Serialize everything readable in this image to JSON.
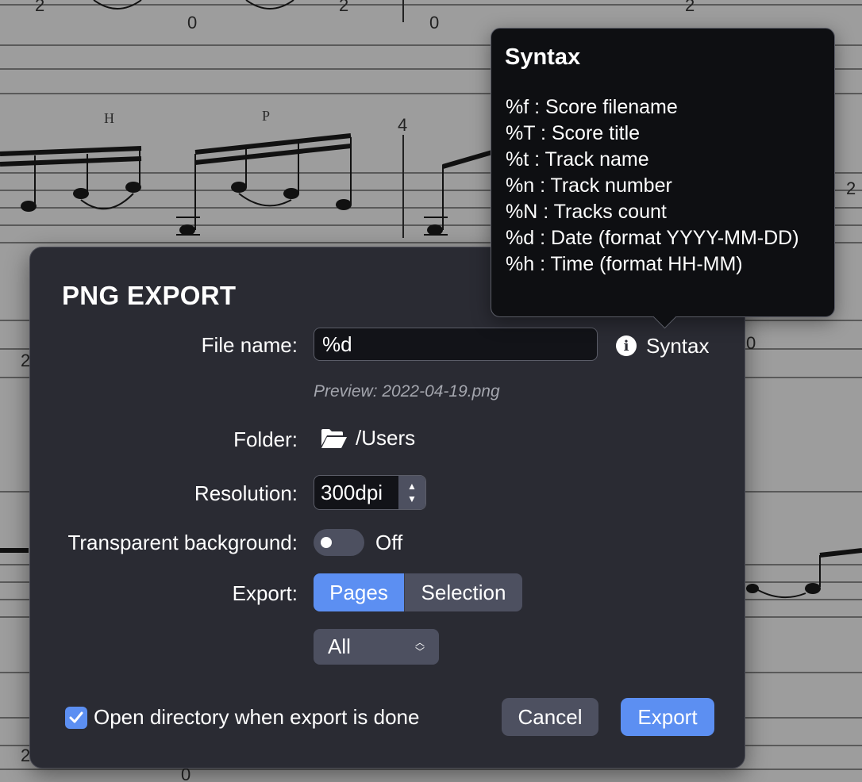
{
  "background_score": {
    "technique_marks": [
      "H",
      "P"
    ],
    "measure_number": "4",
    "tab_numbers": [
      "2",
      "0",
      "2",
      "0",
      "2",
      "2",
      "0",
      "2",
      "2",
      "0"
    ]
  },
  "dialog": {
    "title": "PNG EXPORT",
    "file_name": {
      "label": "File name:",
      "value": "%d",
      "syntax_label": "Syntax",
      "preview": "Preview: 2022-04-19.png"
    },
    "folder": {
      "label": "Folder:",
      "path": "/Users",
      "icon": "folder-open-icon"
    },
    "resolution": {
      "label": "Resolution:",
      "value": "300dpi"
    },
    "transparent_background": {
      "label": "Transparent background:",
      "state": "Off",
      "enabled": false
    },
    "export": {
      "label": "Export:",
      "options": [
        "Pages",
        "Selection"
      ],
      "selected": "Pages",
      "range_value": "All"
    },
    "open_directory": {
      "label": "Open directory when export is done",
      "checked": true
    },
    "buttons": {
      "cancel": "Cancel",
      "export": "Export"
    }
  },
  "tooltip": {
    "title": "Syntax",
    "lines": [
      "%f : Score filename",
      "%T : Score title",
      "%t : Track name",
      "%n : Track number",
      "%N : Tracks count",
      "%d : Date (format YYYY-MM-DD)",
      "%h : Time (format HH-MM)"
    ]
  },
  "colors": {
    "accent": "#5c8ff2",
    "dialog_bg": "#2a2b33",
    "tooltip_bg": "#0e0f12",
    "control_bg": "#4d5060"
  }
}
